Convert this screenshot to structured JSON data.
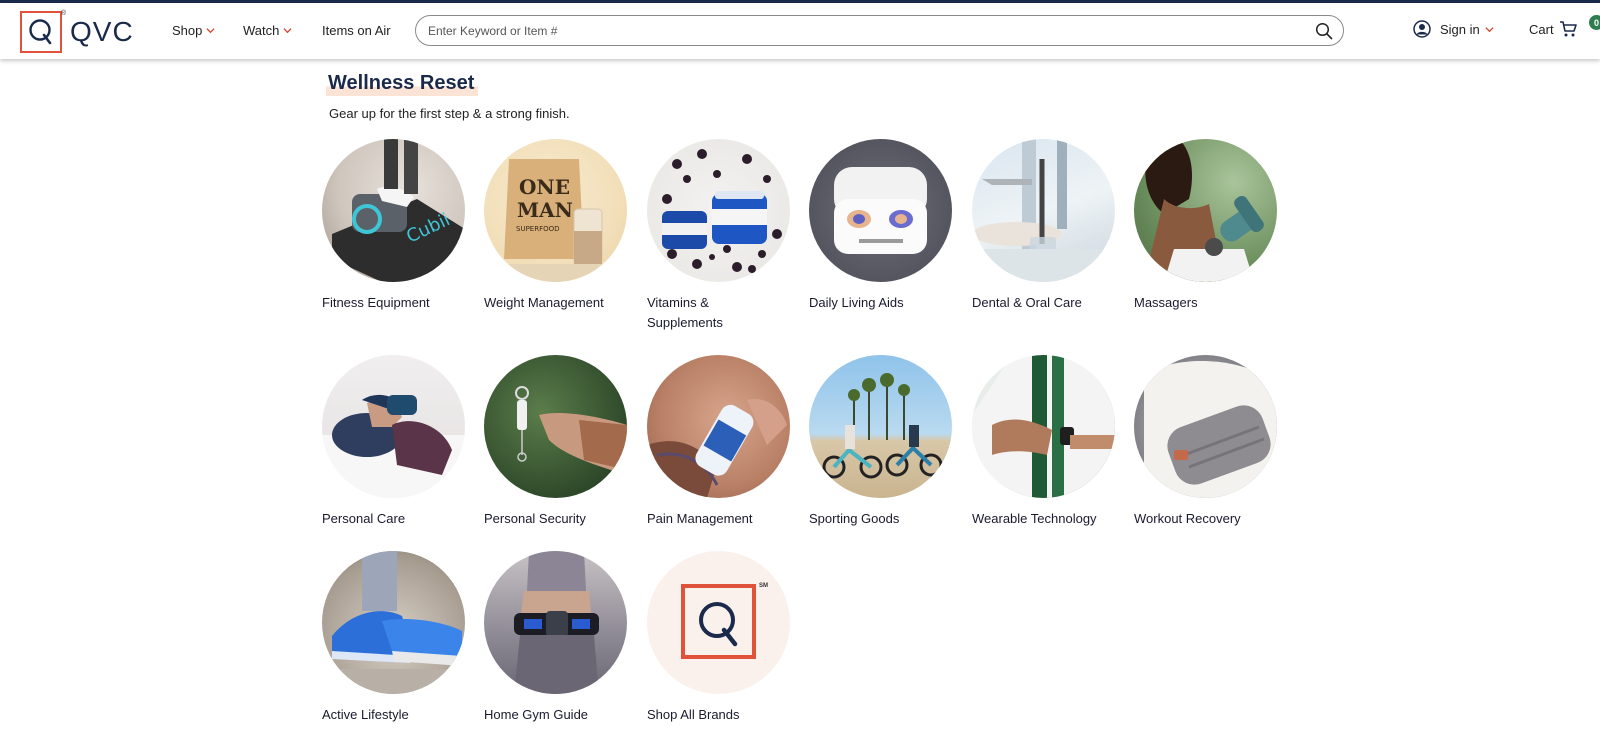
{
  "header": {
    "logo_text": "QVC",
    "logo_mark": "®",
    "nav": [
      {
        "label": "Shop"
      },
      {
        "label": "Watch"
      },
      {
        "label": "Items on Air"
      }
    ],
    "search_placeholder": "Enter Keyword or Item #",
    "signin_label": "Sign in",
    "cart_label": "Cart",
    "cart_count": "0"
  },
  "colors": {
    "brand_navy": "#1b2a4a",
    "accent_red": "#e0523a",
    "cart_badge": "#2e7d4f"
  },
  "page": {
    "title": "Wellness Reset",
    "subtitle": "Gear up for the first step & a strong finish."
  },
  "categories": [
    {
      "label": "Fitness Equipment",
      "image": "fitness-equipment-image"
    },
    {
      "label": "Weight Management",
      "image": "weight-management-image"
    },
    {
      "label": "Vitamins &\nSupplements",
      "image": "vitamins-supplements-image"
    },
    {
      "label": "Daily Living Aids",
      "image": "daily-living-aids-image"
    },
    {
      "label": "Dental & Oral Care",
      "image": "dental-oral-care-image"
    },
    {
      "label": "Massagers",
      "image": "massagers-image"
    },
    {
      "label": "Personal Care",
      "image": "personal-care-image"
    },
    {
      "label": "Personal Security",
      "image": "personal-security-image"
    },
    {
      "label": "Pain Management",
      "image": "pain-management-image"
    },
    {
      "label": "Sporting Goods",
      "image": "sporting-goods-image"
    },
    {
      "label": "Wearable Technology",
      "image": "wearable-technology-image"
    },
    {
      "label": "Workout Recovery",
      "image": "workout-recovery-image"
    },
    {
      "label": "Active Lifestyle",
      "image": "active-lifestyle-image"
    },
    {
      "label": "Home Gym Guide",
      "image": "home-gym-guide-image"
    },
    {
      "label": "Shop All Brands",
      "image": "qvc-logo-image",
      "logo_mark": "SM"
    }
  ]
}
